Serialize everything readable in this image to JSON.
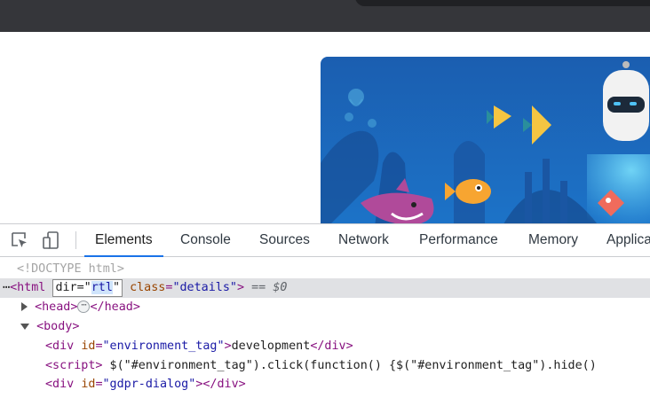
{
  "devtools": {
    "tabs": [
      {
        "label": "Elements",
        "active": true
      },
      {
        "label": "Console",
        "active": false
      },
      {
        "label": "Sources",
        "active": false
      },
      {
        "label": "Network",
        "active": false
      },
      {
        "label": "Performance",
        "active": false
      },
      {
        "label": "Memory",
        "active": false
      },
      {
        "label": "Applica",
        "active": false
      }
    ],
    "icons": {
      "inspect": "inspect-element-icon",
      "device": "device-toolbar-icon"
    },
    "dom": {
      "doctype": "<!DOCTYPE html>",
      "html_line": {
        "gutter": "⋯",
        "open": "<html",
        "edit_attr_prefix": "dir=\"",
        "edit_attr_selected": "rtl",
        "edit_attr_suffix": "\"",
        "class_name": "class",
        "class_eq": "=",
        "class_value": "\"details\"",
        "close": ">",
        "eq": " == ",
        "dollar": "$0"
      },
      "head_line": {
        "open": "<head>",
        "badge": "⋯",
        "close": "</head>"
      },
      "body_line": {
        "open": "<body>"
      },
      "div_env": {
        "open": "<div",
        "attr": "id",
        "eq": "=",
        "value": "\"environment_tag\"",
        "gt": ">",
        "text": "development",
        "close": "</div>"
      },
      "script_line": {
        "open": "<script>",
        "text": " $(\"#environment_tag\").click(function() {$(\"#environment_tag\").hide()"
      },
      "div_gdpr": {
        "open": "<div",
        "attr": "id",
        "eq": "=",
        "value": "\"gdpr-dialog\"",
        "gt": ">",
        "close": "</div>"
      }
    }
  },
  "colors": {
    "accent": "#1a73e8",
    "chrome_dark": "#35363a",
    "hero_blue": "#1f5fb0"
  }
}
